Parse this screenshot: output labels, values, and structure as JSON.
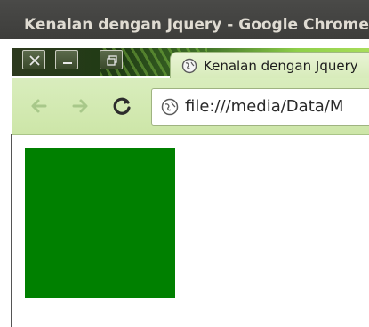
{
  "window": {
    "title": "Kenalan dengan Jquery - Google Chrome"
  },
  "tabs": [
    {
      "label": "Kenalan dengan Jquery",
      "icon": "page-globe-icon",
      "active": true
    }
  ],
  "toolbar": {
    "back_icon": "back-arrow-icon",
    "forward_icon": "forward-arrow-icon",
    "reload_icon": "reload-icon",
    "address": "file:///media/Data/M"
  },
  "page": {
    "box_color": "#008000"
  },
  "colors": {
    "titlebar": "#3d3d3b",
    "toolbar": "#d9edbd",
    "tab": "#eaf4d6",
    "accent_green": "#8fcf4a"
  }
}
